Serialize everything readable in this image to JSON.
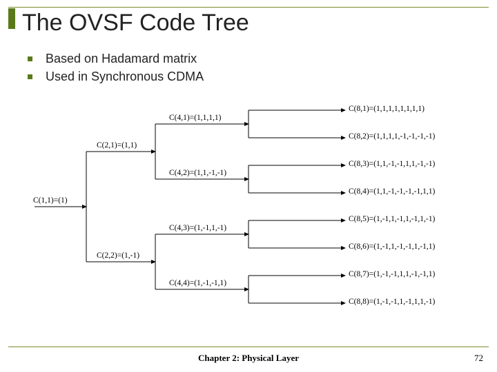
{
  "title": "The OVSF Code Tree",
  "bullets": [
    "Based on Hadamard matrix",
    "Used in Synchronous CDMA"
  ],
  "tree": {
    "c11": "C(1,1)=(1)",
    "c21": "C(2,1)=(1,1)",
    "c22": "C(2,2)=(1,-1)",
    "c41": "C(4,1)=(1,1,1,1)",
    "c42": "C(4,2)=(1,1,-1,-1)",
    "c43": "C(4,3)=(1,-1,1,-1)",
    "c44": "C(4,4)=(1,-1,-1,1)",
    "c81": "C(8,1)=(1,1,1,1,1,1,1,1)",
    "c82": "C(8,2)=(1,1,1,1,-1,-1,-1,-1)",
    "c83": "C(8,3)=(1,1,-1,-1,1,1,-1,-1)",
    "c84": "C(8,4)=(1,1,-1,-1,-1,-1,1,1)",
    "c85": "C(8,5)=(1,-1,1,-1,1,-1,1,-1)",
    "c86": "C(8,6)=(1,-1,1,-1,-1,1,-1,1)",
    "c87": "C(8,7)=(1,-1,-1,1,1,-1,-1,1)",
    "c88": "C(8,8)=(1,-1,-1,1,-1,1,1,-1)"
  },
  "footer": {
    "chapter": "Chapter 2: Physical Layer",
    "page": "72"
  },
  "colors": {
    "accent": "#5a7a1a",
    "rule": "#7a8a2c"
  }
}
